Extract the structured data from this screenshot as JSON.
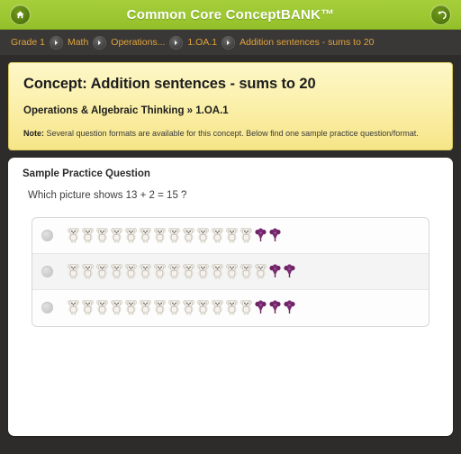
{
  "header": {
    "title": "Common Core ConceptBANK™",
    "home_icon": "home-icon",
    "back_icon": "back-arrow-icon",
    "bar_color": "#9dc832"
  },
  "breadcrumb": {
    "separator_icon": "chevron-right-icon",
    "items": [
      {
        "label": "Grade 1"
      },
      {
        "label": "Math"
      },
      {
        "label": "Operations..."
      },
      {
        "label": "1.OA.1"
      },
      {
        "label": "Addition sentences - sums to 20"
      }
    ],
    "text_color": "#e0a33c",
    "background": "#3a3836"
  },
  "concept": {
    "title": "Concept: Addition sentences - sums to 20",
    "subtitle": "Operations & Algebraic Thinking » 1.OA.1",
    "note_label": "Note:",
    "note_text": " Several question formats are available for this concept. Below find one sample practice question/format.",
    "background": "#fbf0ab"
  },
  "question": {
    "heading": "Sample Practice Question",
    "text": "Which picture shows 13 + 2 = 15 ?",
    "choices": [
      {
        "name": "choice-a",
        "selected": false,
        "dog_count": 13,
        "flower_count": 2,
        "total": 15
      },
      {
        "name": "choice-b",
        "selected": false,
        "dog_count": 14,
        "flower_count": 2,
        "total": 16
      },
      {
        "name": "choice-c",
        "selected": false,
        "dog_count": 13,
        "flower_count": 3,
        "total": 16
      }
    ],
    "dog_icon": "dog-icon",
    "flower_icon": "purple-flower-icon",
    "radio_icon": "radio-button-unselected-icon",
    "dog_color": "#e9e4dc",
    "flower_color": "#7a2a6e"
  }
}
